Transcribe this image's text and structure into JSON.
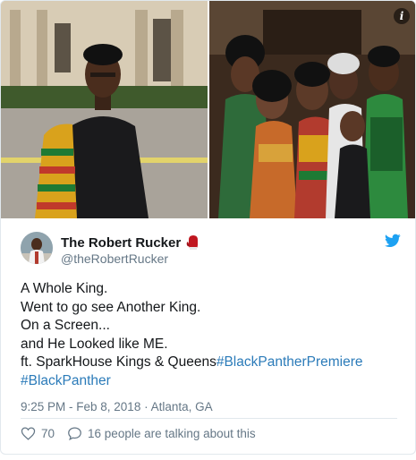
{
  "author": {
    "display_name": "The Robert Rucker",
    "handle": "@theRobertRucker"
  },
  "tweet": {
    "lines": [
      "A Whole King.",
      "Went to go see Another King.",
      "On a Screen...",
      "and He Looked like ME."
    ],
    "last_line_prefix": "ft. SparkHouse Kings & Queens",
    "hashtag_1": "#BlackPantherPremiere",
    "hashtag_2": "#BlackPanther"
  },
  "meta": {
    "timestamp": "9:25 PM - Feb 8, 2018 · Atlanta, GA"
  },
  "actions": {
    "likes": "70",
    "talking": "16 people are talking about this"
  },
  "icons": {
    "heart": "heart-icon",
    "reply": "reply-icon",
    "bird": "twitter-bird-icon",
    "info": "info-icon"
  },
  "colors": {
    "link": "#2b7bb9",
    "secondary_text": "#657786",
    "twitter_blue": "#1da1f2"
  }
}
